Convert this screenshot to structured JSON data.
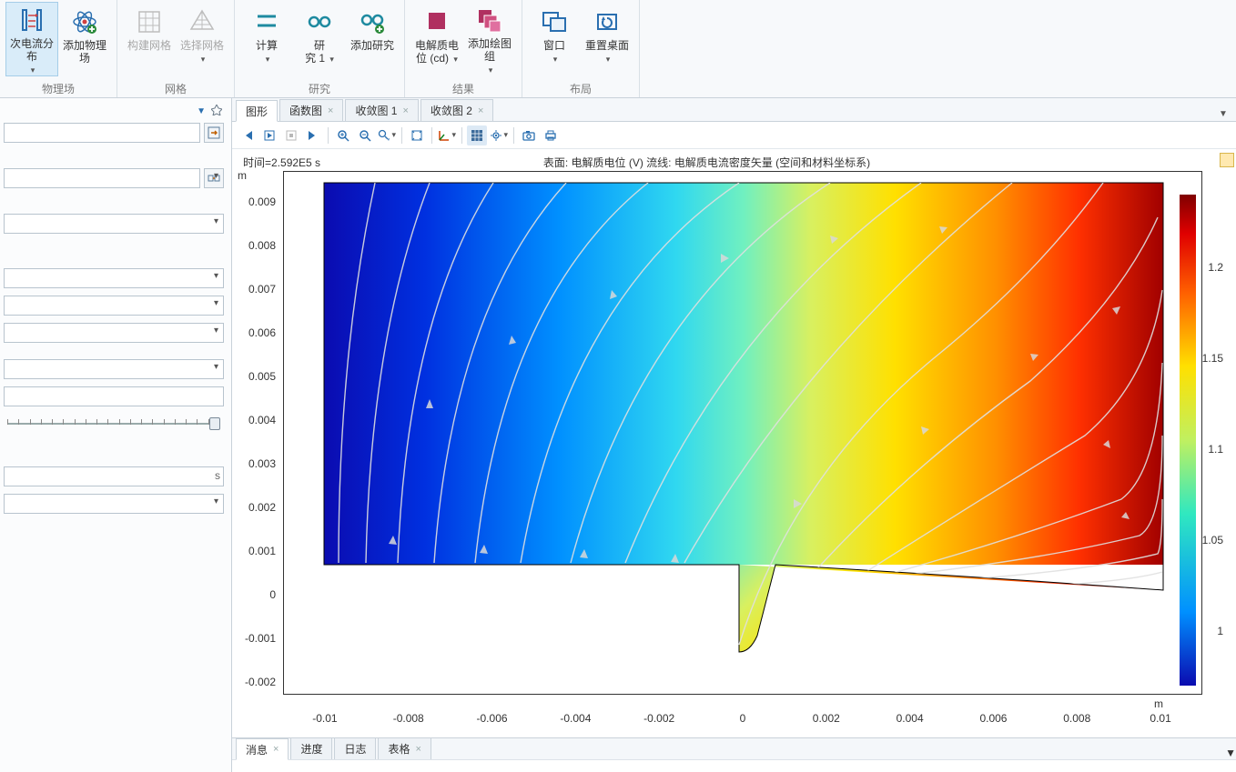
{
  "ribbon": {
    "groups": [
      {
        "name": "物理场",
        "items": [
          {
            "icon": "current-dist-icon",
            "label": "次电流分布\n▾",
            "sel": true,
            "color": "#2a6fb0"
          },
          {
            "icon": "add-physics-icon",
            "label": "添加物理场",
            "color": "#2a6fb0"
          }
        ]
      },
      {
        "name": "网格",
        "items": [
          {
            "icon": "build-mesh-icon",
            "label": "构建网格",
            "dis": true,
            "color": "#bdbdbd"
          },
          {
            "icon": "select-mesh-icon",
            "label": "选择网格\n▾",
            "dis": true,
            "color": "#bdbdbd"
          }
        ]
      },
      {
        "name": "研究",
        "items": [
          {
            "icon": "compute-icon",
            "label": "计算\n▾",
            "color": "#1e8aa0"
          },
          {
            "icon": "study-icon",
            "label": "研\n究 1 ▾",
            "color": "#1e8aa0"
          },
          {
            "icon": "add-study-icon",
            "label": "添加研究",
            "color": "#1e8aa0"
          }
        ]
      },
      {
        "name": "结果",
        "items": [
          {
            "icon": "plot-cd-icon",
            "label": "电解质电\n位 (cd) ▾",
            "color": "#b03060"
          },
          {
            "icon": "add-plotgroup-icon",
            "label": "添加绘图组\n▾",
            "color": "#b03060"
          }
        ]
      },
      {
        "name": "布局",
        "items": [
          {
            "icon": "window-icon",
            "label": "窗口\n▾",
            "color": "#2a6fb0"
          },
          {
            "icon": "reset-desktop-icon",
            "label": "重置桌面\n▾",
            "color": "#2a6fb0"
          }
        ]
      }
    ]
  },
  "left_panel": {
    "unit_s": "s"
  },
  "content_tabs": [
    {
      "label": "图形",
      "active": true,
      "closable": false
    },
    {
      "label": "函数图",
      "closable": true
    },
    {
      "label": "收敛图 1",
      "closable": true
    },
    {
      "label": "收敛图 2",
      "closable": true
    }
  ],
  "plot": {
    "time_label": "时间=2.592E5 s",
    "title": "表面: 电解质电位 (V)   流线: 电解质电流密度矢量   (空间和材料坐标系)",
    "y_unit": "m",
    "x_unit": "m",
    "y_ticks": [
      "0.009",
      "0.008",
      "0.007",
      "0.006",
      "0.005",
      "0.004",
      "0.003",
      "0.002",
      "0.001",
      "0",
      "-0.001",
      "-0.002"
    ],
    "x_ticks": [
      "-0.01",
      "-0.008",
      "-0.006",
      "-0.004",
      "-0.002",
      "0",
      "0.002",
      "0.004",
      "0.006",
      "0.008",
      "0.01"
    ],
    "cb_ticks": [
      "1.2",
      "1.15",
      "1.1",
      "1.05",
      "1"
    ]
  },
  "bottom_tabs": [
    {
      "label": "消息",
      "active": true,
      "closable": true
    },
    {
      "label": "进度"
    },
    {
      "label": "日志"
    },
    {
      "label": "表格",
      "closable": true
    }
  ],
  "chart_data": {
    "type": "heatmap",
    "title": "表面: 电解质电位 (V)   流线: 电解质电流密度矢量   (空间和材料坐标系)",
    "time": "2.592E5 s",
    "xlabel": "m",
    "ylabel": "m",
    "xlim": [
      -0.011,
      0.011
    ],
    "ylim": [
      -0.0023,
      0.0097
    ],
    "colorbar_range": [
      0.97,
      1.24
    ],
    "colorbar_ticks": [
      1.0,
      1.05,
      1.1,
      1.15,
      1.2
    ],
    "colormap": "rainbow",
    "note": "2D field of electrolyte potential (V) with streamlines of electrolyte current density. Domain is rectangle x∈[-0.01,0.01], y∈[0,0.0095] with an additional curved lobe under x>0 down to y≈-0.0017. Potential increases roughly left→right from ~0.97V (deep blue) to ~1.24V (dark red)."
  }
}
